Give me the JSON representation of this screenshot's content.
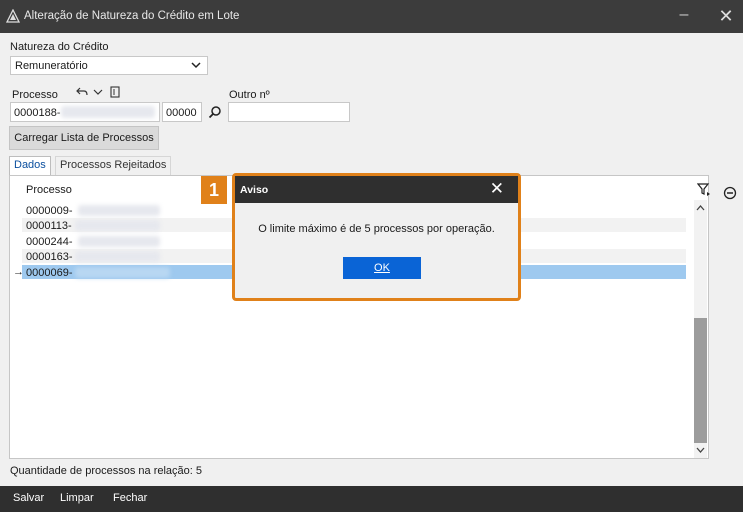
{
  "window": {
    "title": "Alteração de Natureza do Crédito em Lote",
    "minimize_icon": "minimize-icon",
    "close_icon": "close-icon"
  },
  "form": {
    "natureza_label": "Natureza do Crédito",
    "natureza_value": "Remuneratório",
    "processo_label": "Processo",
    "processo_prefix": "0000188-",
    "processo_suffix": "00000",
    "outro_label": "Outro nº",
    "outro_value": "",
    "load_button": "Carregar Lista de Processos"
  },
  "tabs": [
    {
      "label": "Dados"
    },
    {
      "label": "Processos Rejeitados"
    }
  ],
  "grid": {
    "header": "Processo",
    "rows": [
      {
        "value": "0000009-"
      },
      {
        "value": "0000113-"
      },
      {
        "value": "0000244-"
      },
      {
        "value": "0000163-"
      },
      {
        "value": "0000069-"
      }
    ],
    "selected_row_indicator": "→"
  },
  "status": {
    "count_text": "Quantidade de processos na relação: 5"
  },
  "bottom": {
    "save": "Salvar",
    "clear": "Limpar",
    "close": "Fechar"
  },
  "dialog": {
    "badge": "1",
    "title": "Aviso",
    "message": "O limite máximo é de 5 processos por operação.",
    "ok": "OK"
  }
}
